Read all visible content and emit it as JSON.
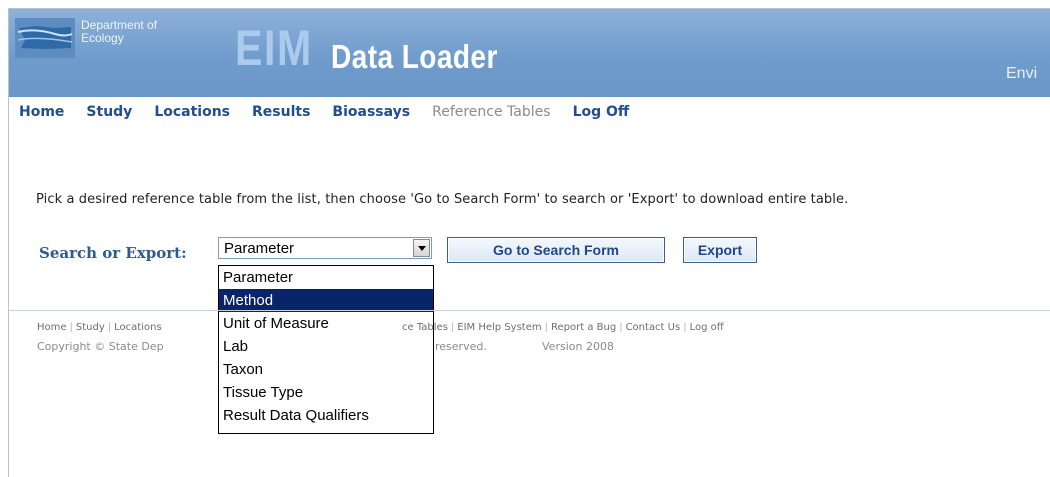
{
  "header": {
    "dept_line1": "Department of",
    "dept_line2": "Ecology",
    "eim_mark": "EIM",
    "app_title": "Data Loader",
    "right_text": "Envi"
  },
  "nav": {
    "items": [
      {
        "label": "Home",
        "enabled": true
      },
      {
        "label": "Study",
        "enabled": true
      },
      {
        "label": "Locations",
        "enabled": true
      },
      {
        "label": "Results",
        "enabled": true
      },
      {
        "label": "Bioassays",
        "enabled": true
      },
      {
        "label": "Reference Tables",
        "enabled": false
      },
      {
        "label": "Log Off",
        "enabled": true
      }
    ]
  },
  "main": {
    "instructions": "Pick a desired reference table from the list, then choose 'Go to Search Form' to search or 'Export' to download entire table.",
    "search_label": "Search or Export:",
    "select_value": "Parameter",
    "options": [
      "Parameter",
      "Method",
      "Unit of Measure",
      "Lab",
      "Taxon",
      "Tissue Type",
      "Result Data Qualifiers"
    ],
    "highlighted_option": "Method",
    "search_button": "Go to Search Form",
    "export_button": "Export"
  },
  "footer": {
    "links_left": [
      "Home",
      "Study",
      "Locations"
    ],
    "links_right": [
      "ce Tables",
      "EIM Help System",
      "Report a Bug",
      "Contact Us",
      "Log off"
    ],
    "copyright": "Copyright ©  State Dep",
    "rights": "reserved.",
    "version": "Version 2008"
  },
  "colors": {
    "banner": "#7aa5d3",
    "nav_link": "#214e8c",
    "selection": "#0a246a"
  }
}
